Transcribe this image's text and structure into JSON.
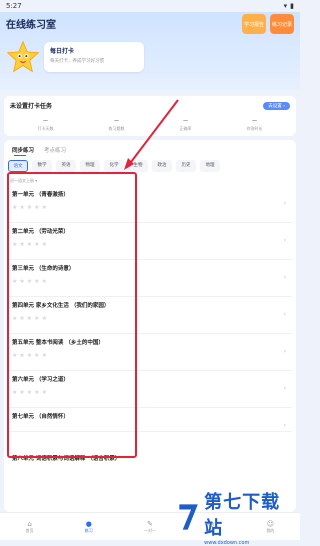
{
  "status": {
    "time": "5:27"
  },
  "header": {
    "title": "在线练习室",
    "top_buttons": [
      "学习报告",
      "练习记录"
    ]
  },
  "checkin": {
    "title": "每日打卡",
    "subtitle": "每天打卡，养成学习好习惯"
  },
  "tasks": {
    "title": "未设置打卡任务",
    "button": "去设置 ›",
    "stats": [
      {
        "value": "—",
        "label": "打卡天数"
      },
      {
        "value": "—",
        "label": "练习题数"
      },
      {
        "value": "—",
        "label": "正确率"
      },
      {
        "value": "—",
        "label": "作答时长"
      }
    ]
  },
  "practice": {
    "tabs": [
      "同步练习",
      "考点练习"
    ],
    "active_tab": 0,
    "subjects": [
      "语文",
      "数学",
      "英语",
      "物理",
      "化学",
      "生物",
      "政治",
      "历史",
      "地理"
    ],
    "active_subject": 0,
    "grade": "初一语文上册 ▾",
    "units": [
      "第一单元 （青春激扬）",
      "第二单元 （劳动光荣）",
      "第三单元 （生命的诗意）",
      "第四单元 家乡文化生活 （我们的家园）",
      "第五单元 整本书阅读 （乡土的中国）",
      "第六单元 （学习之道）",
      "第七单元 （自然情怀）",
      "第八单元 词语积累与词语解释 （语言积累）"
    ]
  },
  "bottom_nav": [
    {
      "icon": "⌂",
      "label": "首页"
    },
    {
      "icon": "●",
      "label": "练习"
    },
    {
      "icon": "✎",
      "label": "一对一"
    },
    {
      "icon": "◎",
      "label": "发现"
    },
    {
      "icon": "☺",
      "label": "我的"
    }
  ],
  "watermark": {
    "text": "第七下载站",
    "url": "www.dxdown.com"
  },
  "colors": {
    "accent": "#2e6bf6",
    "highlight": "#e3233a",
    "star_empty": "#d8d8d8"
  }
}
